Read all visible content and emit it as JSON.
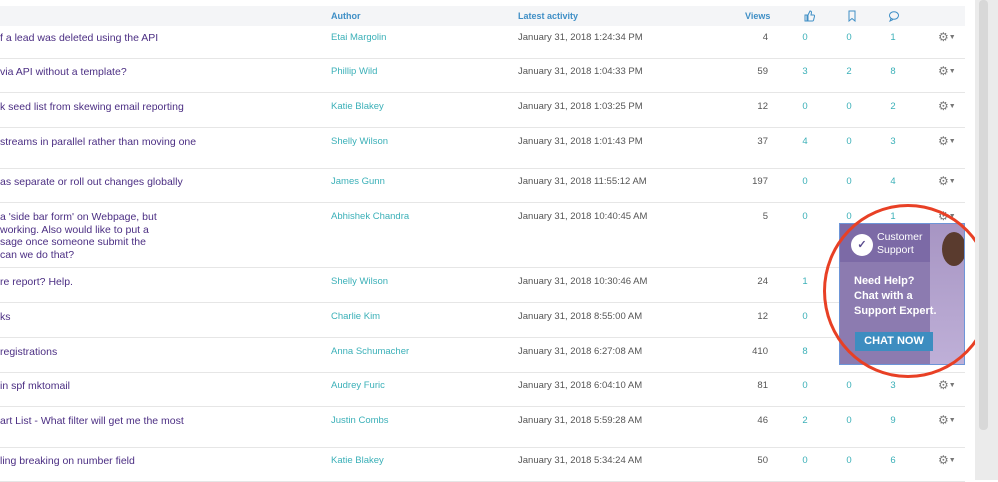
{
  "header": {
    "author": "Author",
    "latest_activity": "Latest activity",
    "views": "Views",
    "likes_icon": "thumbs-up-icon",
    "bookmarks_icon": "bookmark-icon",
    "comments_icon": "comment-icon"
  },
  "rows": [
    {
      "title": "f a lead was deleted using the API",
      "author": "Etai Margolin",
      "date": "January 31, 2018 1:24:34 PM",
      "views": "4",
      "likes": "0",
      "bookmarks": "0",
      "comments": "1"
    },
    {
      "title": "via API without a template?",
      "author": "Phillip Wild",
      "date": "January 31, 2018 1:04:33 PM",
      "views": "59",
      "likes": "3",
      "bookmarks": "2",
      "comments": "8"
    },
    {
      "title": "k seed list from skewing email reporting",
      "author": "Katie Blakey",
      "date": "January 31, 2018 1:03:25 PM",
      "views": "12",
      "likes": "0",
      "bookmarks": "0",
      "comments": "2"
    },
    {
      "title": " streams in parallel rather than moving one",
      "author": "Shelly Wilson",
      "date": "January 31, 2018 1:01:43 PM",
      "views": "37",
      "likes": "4",
      "bookmarks": "0",
      "comments": "3"
    },
    {
      "title": "as separate or roll out changes globally",
      "author": "James Gunn",
      "date": "January 31, 2018 11:55:12 AM",
      "views": "197",
      "likes": "0",
      "bookmarks": "0",
      "comments": "4"
    },
    {
      "title": " a 'side bar form' on Webpage, but\n working. Also would like to put a\nsage once someone submit the\n can we do that?",
      "author": "Abhishek Chandra",
      "date": "January 31, 2018 10:40:45 AM",
      "views": "5",
      "likes": "0",
      "bookmarks": "0",
      "comments": "1"
    },
    {
      "title": "re report? Help.",
      "author": "Shelly Wilson",
      "date": "January 31, 2018 10:30:46 AM",
      "views": "24",
      "likes": "1",
      "bookmarks": "",
      "comments": ""
    },
    {
      "title": "ks",
      "author": "Charlie Kim",
      "date": "January 31, 2018 8:55:00 AM",
      "views": "12",
      "likes": "0",
      "bookmarks": "",
      "comments": ""
    },
    {
      "title": "registrations",
      "author": "Anna Schumacher",
      "date": "January 31, 2018 6:27:08 AM",
      "views": "410",
      "likes": "8",
      "bookmarks": "",
      "comments": ""
    },
    {
      "title": " in spf mktomail",
      "author": "Audrey Furic",
      "date": "January 31, 2018 6:04:10 AM",
      "views": "81",
      "likes": "0",
      "bookmarks": "0",
      "comments": "3"
    },
    {
      "title": "art List - What filter will get me the most",
      "author": "Justin Combs",
      "date": "January 31, 2018 5:59:28 AM",
      "views": "46",
      "likes": "2",
      "bookmarks": "0",
      "comments": "9"
    },
    {
      "title": "ling breaking on number field",
      "author": "Katie Blakey",
      "date": "January 31, 2018 5:34:24 AM",
      "views": "50",
      "likes": "0",
      "bookmarks": "0",
      "comments": "6"
    }
  ],
  "ad": {
    "brand_line": "Customer Support",
    "headline_1": "Need Help?",
    "headline_2": "Chat with a",
    "headline_3": "Support Expert.",
    "button": "CHAT NOW"
  },
  "gear_icon": "gear-icon",
  "colors": {
    "link": "#3bb0b8",
    "title": "#4b2e83",
    "header": "#3f8fc6",
    "highlight": "#e84025"
  }
}
